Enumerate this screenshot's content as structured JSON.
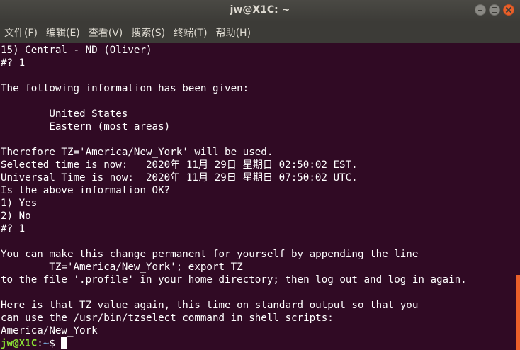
{
  "window": {
    "title": "jw@X1C: ~"
  },
  "menu": [
    "文件(F)",
    "编辑(E)",
    "查看(V)",
    "搜索(S)",
    "终端(T)",
    "帮助(H)"
  ],
  "terminal": {
    "lines": [
      "15) Central - ND (Oliver)",
      "#? 1",
      "",
      "The following information has been given:",
      "",
      "        United States",
      "        Eastern (most areas)",
      "",
      "Therefore TZ='America/New_York' will be used.",
      "Selected time is now:   2020年 11月 29日 星期日 02:50:02 EST.",
      "Universal Time is now:  2020年 11月 29日 星期日 07:50:02 UTC.",
      "Is the above information OK?",
      "1) Yes",
      "2) No",
      "#? 1",
      "",
      "You can make this change permanent for yourself by appending the line",
      "        TZ='America/New_York'; export TZ",
      "to the file '.profile' in your home directory; then log out and log in again.",
      "",
      "Here is that TZ value again, this time on standard output so that you",
      "can use the /usr/bin/tzselect command in shell scripts:",
      "America/New_York"
    ],
    "prompt_user": "jw@X1C",
    "prompt_sep": ":",
    "prompt_path": "~",
    "prompt_symbol": "$ "
  },
  "colors": {
    "background": "#300a24",
    "prompt_user": "#8ae234",
    "prompt_path": "#729fcf",
    "scroll_thumb": "#e9602a"
  },
  "icons": [
    "minimize-icon",
    "maximize-icon",
    "close-icon"
  ]
}
